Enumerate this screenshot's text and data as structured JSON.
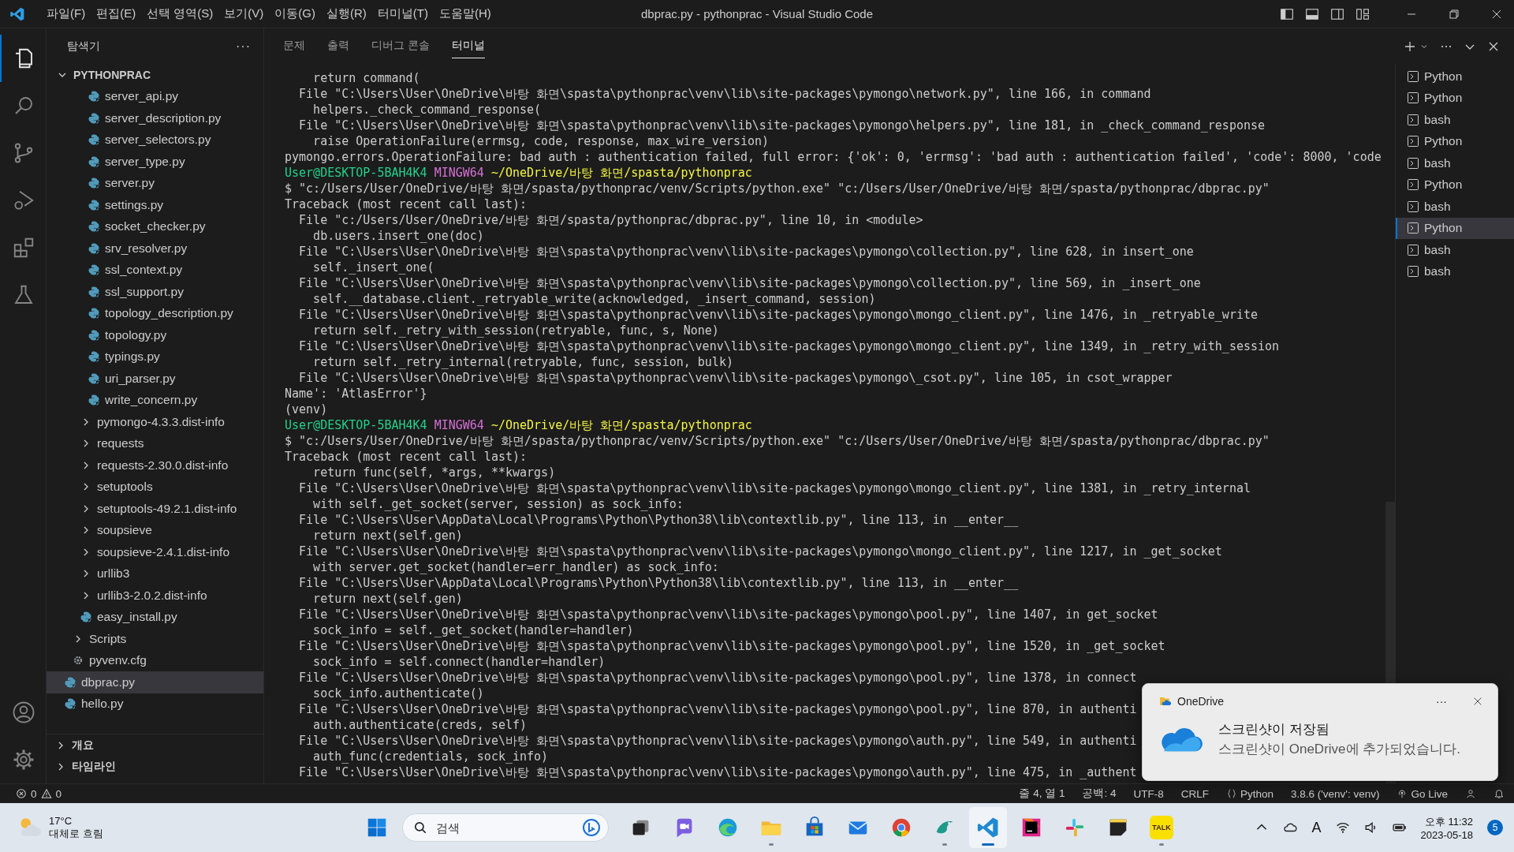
{
  "window": {
    "title": "dbprac.py - pythonprac - Visual Studio Code",
    "menu": [
      "파일(F)",
      "편집(E)",
      "선택 영역(S)",
      "보기(V)",
      "이동(G)",
      "실행(R)",
      "터미널(T)",
      "도움말(H)"
    ]
  },
  "activity_bar": {
    "items": [
      {
        "kind": "explorer",
        "selected": true
      },
      {
        "kind": "search",
        "selected": false
      },
      {
        "kind": "source-control",
        "selected": false
      },
      {
        "kind": "run",
        "selected": false
      },
      {
        "kind": "extensions",
        "selected": false
      },
      {
        "kind": "testing",
        "selected": false
      }
    ],
    "bottom": [
      {
        "kind": "account"
      },
      {
        "kind": "settings"
      }
    ]
  },
  "sidebar": {
    "title": "탐색기",
    "more": "···",
    "tree": {
      "label": "PYTHONPRAC",
      "kind": "root",
      "expanded": true,
      "children": [
        {
          "children": [
            {
              "children": [
                {
                  "children": [
                    {
                      "label": "server_api.py",
                      "kind": "python",
                      "selected": false
                    },
                    {
                      "label": "server_description.py",
                      "kind": "python",
                      "selected": false
                    },
                    {
                      "label": "server_selectors.py",
                      "kind": "python",
                      "selected": false
                    },
                    {
                      "label": "server_type.py",
                      "kind": "python",
                      "selected": false
                    },
                    {
                      "label": "server.py",
                      "kind": "python",
                      "selected": false
                    },
                    {
                      "label": "settings.py",
                      "kind": "python",
                      "selected": false
                    },
                    {
                      "label": "socket_checker.py",
                      "kind": "python",
                      "selected": false
                    },
                    {
                      "label": "srv_resolver.py",
                      "kind": "python",
                      "selected": false
                    },
                    {
                      "label": "ssl_context.py",
                      "kind": "python",
                      "selected": false
                    },
                    {
                      "label": "ssl_support.py",
                      "kind": "python",
                      "selected": false
                    },
                    {
                      "label": "topology_description.py",
                      "kind": "python",
                      "selected": false
                    },
                    {
                      "label": "topology.py",
                      "kind": "python",
                      "selected": false
                    },
                    {
                      "label": "typings.py",
                      "kind": "python",
                      "selected": false
                    },
                    {
                      "label": "uri_parser.py",
                      "kind": "python",
                      "selected": false
                    },
                    {
                      "label": "write_concern.py",
                      "kind": "python",
                      "selected": false
                    }
                  ]
                },
                {
                  "label": "pymongo-4.3.3.dist-info",
                  "kind": "folder",
                  "expanded": false,
                  "selected": false
                },
                {
                  "label": "requests",
                  "kind": "folder",
                  "expanded": false,
                  "selected": false
                },
                {
                  "label": "requests-2.30.0.dist-info",
                  "kind": "folder",
                  "expanded": false,
                  "selected": false
                },
                {
                  "label": "setuptools",
                  "kind": "folder",
                  "expanded": false,
                  "selected": false
                },
                {
                  "label": "setuptools-49.2.1.dist-info",
                  "kind": "folder",
                  "expanded": false,
                  "selected": false
                },
                {
                  "label": "soupsieve",
                  "kind": "folder",
                  "expanded": false,
                  "selected": false
                },
                {
                  "label": "soupsieve-2.4.1.dist-info",
                  "kind": "folder",
                  "expanded": false,
                  "selected": false
                },
                {
                  "label": "urllib3",
                  "kind": "folder",
                  "expanded": false,
                  "selected": false
                },
                {
                  "label": "urllib3-2.0.2.dist-info",
                  "kind": "folder",
                  "expanded": false,
                  "selected": false
                },
                {
                  "label": "easy_install.py",
                  "kind": "python",
                  "selected": false
                }
              ]
            },
            {
              "label": "Scripts",
              "kind": "folder",
              "expanded": false,
              "selected": false
            },
            {
              "label": "pyvenv.cfg",
              "kind": "config",
              "selected": false
            }
          ]
        },
        {
          "label": "dbprac.py",
          "kind": "python",
          "selected": true
        },
        {
          "label": "hello.py",
          "kind": "python",
          "selected": false
        }
      ]
    },
    "sections": [
      {
        "label": "개요",
        "expanded": false
      },
      {
        "label": "타임라인",
        "expanded": false
      }
    ]
  },
  "panel": {
    "tabs": [
      {
        "label": "문제",
        "selected": false
      },
      {
        "label": "출력",
        "selected": false
      },
      {
        "label": "디버그 콘솔",
        "selected": false
      },
      {
        "label": "터미널",
        "selected": true
      }
    ]
  },
  "terminal": {
    "lines": [
      {
        "kind": "text",
        "text": "    return command("
      },
      {
        "kind": "text",
        "text": "  File \"C:\\Users\\User\\OneDrive\\바탕 화면\\spasta\\pythonprac\\venv\\lib\\site-packages\\pymongo\\network.py\", line 166, in command"
      },
      {
        "kind": "text",
        "text": "    helpers._check_command_response("
      },
      {
        "kind": "text",
        "text": "  File \"C:\\Users\\User\\OneDrive\\바탕 화면\\spasta\\pythonprac\\venv\\lib\\site-packages\\pymongo\\helpers.py\", line 181, in _check_command_response"
      },
      {
        "kind": "text",
        "text": "    raise OperationFailure(errmsg, code, response, max_wire_version)"
      },
      {
        "kind": "text",
        "text": "pymongo.errors.OperationFailure: bad auth : authentication failed, full error: {'ok': 0, 'errmsg': 'bad auth : authentication failed', 'code': 8000, 'code"
      },
      {
        "kind": "prompt",
        "user": "User@DESKTOP-5BAH4K4",
        "shell": "MINGW64",
        "path": "~/OneDrive/바탕 화면/spasta/pythonprac"
      },
      {
        "kind": "text",
        "text": "$ \"c:/Users/User/OneDrive/바탕 화면/spasta/pythonprac/venv/Scripts/python.exe\" \"c:/Users/User/OneDrive/바탕 화면/spasta/pythonprac/dbprac.py\""
      },
      {
        "kind": "text",
        "text": "Traceback (most recent call last):"
      },
      {
        "kind": "text",
        "text": "  File \"c:/Users/User/OneDrive/바탕 화면/spasta/pythonprac/dbprac.py\", line 10, in <module>"
      },
      {
        "kind": "text",
        "text": "    db.users.insert_one(doc)"
      },
      {
        "kind": "text",
        "text": "  File \"C:\\Users\\User\\OneDrive\\바탕 화면\\spasta\\pythonprac\\venv\\lib\\site-packages\\pymongo\\collection.py\", line 628, in insert_one"
      },
      {
        "kind": "text",
        "text": "    self._insert_one("
      },
      {
        "kind": "text",
        "text": "  File \"C:\\Users\\User\\OneDrive\\바탕 화면\\spasta\\pythonprac\\venv\\lib\\site-packages\\pymongo\\collection.py\", line 569, in _insert_one"
      },
      {
        "kind": "text",
        "text": "    self.__database.client._retryable_write(acknowledged, _insert_command, session)"
      },
      {
        "kind": "text",
        "text": "  File \"C:\\Users\\User\\OneDrive\\바탕 화면\\spasta\\pythonprac\\venv\\lib\\site-packages\\pymongo\\mongo_client.py\", line 1476, in _retryable_write"
      },
      {
        "kind": "text",
        "text": "    return self._retry_with_session(retryable, func, s, None)"
      },
      {
        "kind": "text",
        "text": "  File \"C:\\Users\\User\\OneDrive\\바탕 화면\\spasta\\pythonprac\\venv\\lib\\site-packages\\pymongo\\mongo_client.py\", line 1349, in _retry_with_session"
      },
      {
        "kind": "text",
        "text": "    return self._retry_internal(retryable, func, session, bulk)"
      },
      {
        "kind": "text",
        "text": "  File \"C:\\Users\\User\\OneDrive\\바탕 화면\\spasta\\pythonprac\\venv\\lib\\site-packages\\pymongo\\_csot.py\", line 105, in csot_wrapper"
      },
      {
        "kind": "text",
        "text": "Name': 'AtlasError'}"
      },
      {
        "kind": "text",
        "text": "(venv)"
      },
      {
        "kind": "prompt",
        "user": "User@DESKTOP-5BAH4K4",
        "shell": "MINGW64",
        "path": "~/OneDrive/바탕 화면/spasta/pythonprac"
      },
      {
        "kind": "text",
        "text": "$ \"c:/Users/User/OneDrive/바탕 화면/spasta/pythonprac/venv/Scripts/python.exe\" \"c:/Users/User/OneDrive/바탕 화면/spasta/pythonprac/dbprac.py\""
      },
      {
        "kind": "text",
        "text": "Traceback (most recent call last):"
      },
      {
        "kind": "text",
        "text": "    return func(self, *args, **kwargs)"
      },
      {
        "kind": "text",
        "text": "  File \"C:\\Users\\User\\OneDrive\\바탕 화면\\spasta\\pythonprac\\venv\\lib\\site-packages\\pymongo\\mongo_client.py\", line 1381, in _retry_internal"
      },
      {
        "kind": "text",
        "text": "    with self._get_socket(server, session) as sock_info:"
      },
      {
        "kind": "text",
        "text": "  File \"C:\\Users\\User\\AppData\\Local\\Programs\\Python\\Python38\\lib\\contextlib.py\", line 113, in __enter__"
      },
      {
        "kind": "text",
        "text": "    return next(self.gen)"
      },
      {
        "kind": "text",
        "text": "  File \"C:\\Users\\User\\OneDrive\\바탕 화면\\spasta\\pythonprac\\venv\\lib\\site-packages\\pymongo\\mongo_client.py\", line 1217, in _get_socket"
      },
      {
        "kind": "text",
        "text": "    with server.get_socket(handler=err_handler) as sock_info:"
      },
      {
        "kind": "text",
        "text": "  File \"C:\\Users\\User\\AppData\\Local\\Programs\\Python\\Python38\\lib\\contextlib.py\", line 113, in __enter__"
      },
      {
        "kind": "text",
        "text": "    return next(self.gen)"
      },
      {
        "kind": "text",
        "text": "  File \"C:\\Users\\User\\OneDrive\\바탕 화면\\spasta\\pythonprac\\venv\\lib\\site-packages\\pymongo\\pool.py\", line 1407, in get_socket"
      },
      {
        "kind": "text",
        "text": "    sock_info = self._get_socket(handler=handler)"
      },
      {
        "kind": "text",
        "text": "  File \"C:\\Users\\User\\OneDrive\\바탕 화면\\spasta\\pythonprac\\venv\\lib\\site-packages\\pymongo\\pool.py\", line 1520, in _get_socket"
      },
      {
        "kind": "text",
        "text": "    sock_info = self.connect(handler=handler)"
      },
      {
        "kind": "text",
        "text": "  File \"C:\\Users\\User\\OneDrive\\바탕 화면\\spasta\\pythonprac\\venv\\lib\\site-packages\\pymongo\\pool.py\", line 1378, in connect"
      },
      {
        "kind": "text",
        "text": "    sock_info.authenticate()"
      },
      {
        "kind": "text",
        "text": "  File \"C:\\Users\\User\\OneDrive\\바탕 화면\\spasta\\pythonprac\\venv\\lib\\site-packages\\pymongo\\pool.py\", line 870, in authenti"
      },
      {
        "kind": "text",
        "text": "    auth.authenticate(creds, self)"
      },
      {
        "kind": "text",
        "text": "  File \"C:\\Users\\User\\OneDrive\\바탕 화면\\spasta\\pythonprac\\venv\\lib\\site-packages\\pymongo\\auth.py\", line 549, in authenti"
      },
      {
        "kind": "text",
        "text": "    auth_func(credentials, sock_info)"
      },
      {
        "kind": "text",
        "text": "  File \"C:\\Users\\User\\OneDrive\\바탕 화면\\spasta\\pythonprac\\venv\\lib\\site-packages\\pymongo\\auth.py\", line 475, in _authent"
      }
    ],
    "sessions": [
      {
        "label": "Python",
        "selected": false
      },
      {
        "label": "Python",
        "selected": false
      },
      {
        "label": "bash",
        "selected": false
      },
      {
        "label": "Python",
        "selected": false
      },
      {
        "label": "bash",
        "selected": false
      },
      {
        "label": "Python",
        "selected": false
      },
      {
        "label": "bash",
        "selected": false
      },
      {
        "label": "Python",
        "selected": true
      },
      {
        "label": "bash",
        "selected": false
      },
      {
        "label": "bash",
        "selected": false
      }
    ]
  },
  "notification": {
    "app": "OneDrive",
    "more": "···",
    "title": "스크린샷이 저장됨",
    "body": "스크린샷이 OneDrive에 추가되었습니다."
  },
  "status_bar": {
    "errors": "0",
    "warnings": "0",
    "items": [
      "줄 4, 열 1",
      "공백: 4",
      "UTF-8",
      "CRLF"
    ],
    "language": "Python",
    "interpreter": "3.8.6 ('venv': venv)",
    "live": "Go Live"
  },
  "taskbar": {
    "weather": {
      "temp": "17°C",
      "condition": "대체로 흐림"
    },
    "search": {
      "placeholder": "검색"
    },
    "apps": [
      {
        "kind": "task-view",
        "running": false,
        "selected": false
      },
      {
        "kind": "chat",
        "running": false,
        "selected": false
      },
      {
        "kind": "edge",
        "running": false,
        "selected": false
      },
      {
        "kind": "folder",
        "running": true,
        "selected": false
      },
      {
        "kind": "store",
        "running": false,
        "selected": false
      },
      {
        "kind": "mail",
        "running": false,
        "selected": false
      },
      {
        "kind": "chrome",
        "running": false,
        "selected": false
      },
      {
        "kind": "bird",
        "running": true,
        "selected": false
      },
      {
        "kind": "vscode",
        "running": true,
        "selected": true
      },
      {
        "kind": "jetbrains",
        "running": false,
        "selected": false
      },
      {
        "kind": "slack",
        "running": false,
        "selected": false
      },
      {
        "kind": "note",
        "running": false,
        "selected": false
      },
      {
        "kind": "talk",
        "label": "TALK",
        "running": true,
        "selected": false
      }
    ],
    "tray": {
      "ime": "A",
      "time": "오후 11:32",
      "date": "2023-05-18",
      "badge": "5"
    }
  }
}
